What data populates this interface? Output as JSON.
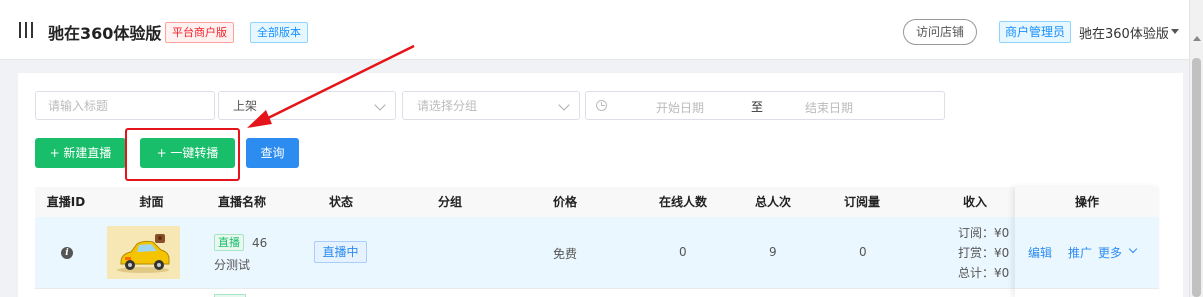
{
  "header": {
    "shop_title": "驰在360体验版",
    "tag_platform": "平台商户版",
    "tag_version": "全部版本",
    "visit_button": "访问店铺",
    "role_tag": "商户管理员",
    "user_name": "驰在360体验版"
  },
  "filters": {
    "title_placeholder": "请输入标题",
    "status_value": "上架",
    "group_placeholder": "请选择分组",
    "start_date_placeholder": "开始日期",
    "date_separator": "至",
    "end_date_placeholder": "结束日期"
  },
  "actions": {
    "new_live_label": "+ 新建直播",
    "one_click_relay_label": "+ 一键转播",
    "query_label": "查询"
  },
  "table": {
    "columns": [
      "直播ID",
      "封面",
      "直播名称",
      "状态",
      "分组",
      "价格",
      "在线人数",
      "总人次",
      "订阅量",
      "收入",
      "操作"
    ],
    "rows": [
      {
        "live_badge": "直播",
        "name_line1": "46",
        "name_line2": "分测试",
        "status": "直播中",
        "group": "",
        "price": "免费",
        "online": "0",
        "total_visits": "9",
        "subscriptions": "0",
        "income_subscribe": "订阅：¥0",
        "income_reward": "打赏：¥0",
        "income_total": "总计：¥0",
        "op_edit": "编辑",
        "op_promote": "推广",
        "op_more": "更多"
      }
    ]
  },
  "colors": {
    "primary_green": "#19be6b",
    "primary_blue": "#2d8cf0",
    "annotation_red": "#e5141a"
  }
}
